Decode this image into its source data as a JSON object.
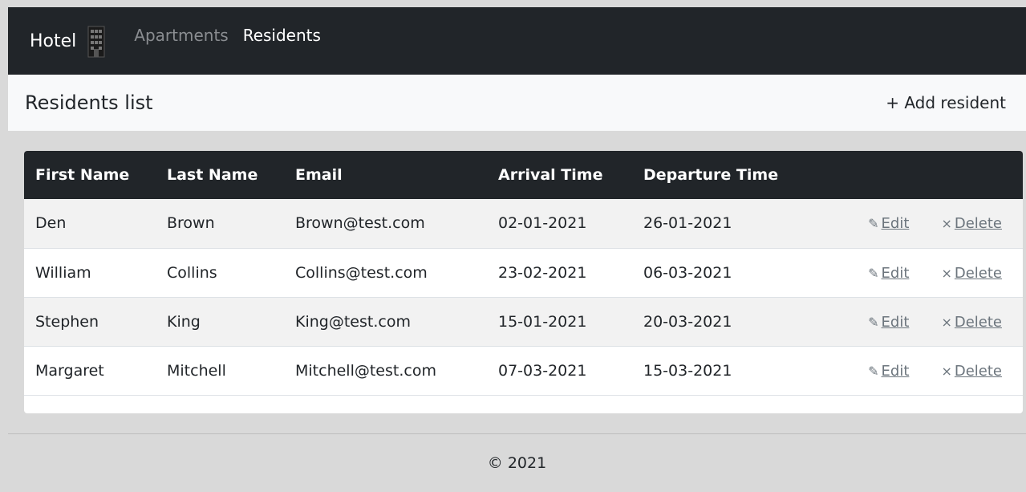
{
  "nav": {
    "brand": "Hotel",
    "brand_icon": "hotel-building-icon",
    "links": [
      {
        "label": "Apartments",
        "active": false
      },
      {
        "label": "Residents",
        "active": true
      }
    ]
  },
  "subheader": {
    "title": "Residents list",
    "add_button": "+ Add resident"
  },
  "table": {
    "headers": [
      "First Name",
      "Last Name",
      "Email",
      "Arrival Time",
      "Departure Time"
    ],
    "rows": [
      {
        "first": "Den",
        "last": "Brown",
        "email": "Brown@test.com",
        "arrival": "02-01-2021",
        "departure": "26-01-2021"
      },
      {
        "first": "William",
        "last": "Collins",
        "email": "Collins@test.com",
        "arrival": "23-02-2021",
        "departure": "06-03-2021"
      },
      {
        "first": "Stephen",
        "last": "King",
        "email": "King@test.com",
        "arrival": "15-01-2021",
        "departure": "20-03-2021"
      },
      {
        "first": "Margaret",
        "last": "Mitchell",
        "email": "Mitchell@test.com",
        "arrival": "07-03-2021",
        "departure": "15-03-2021"
      }
    ],
    "actions": {
      "edit_label": "Edit",
      "edit_icon": "pencil-icon",
      "delete_label": "Delete",
      "delete_icon": "times-icon"
    }
  },
  "footer": {
    "copyright": "© 2021"
  },
  "colors": {
    "navbar_bg": "#212529",
    "subheader_bg": "#f8f9fa",
    "page_bg": "#d9d9d9",
    "row_stripe": "#f2f2f2",
    "action_link": "#6c757d"
  }
}
